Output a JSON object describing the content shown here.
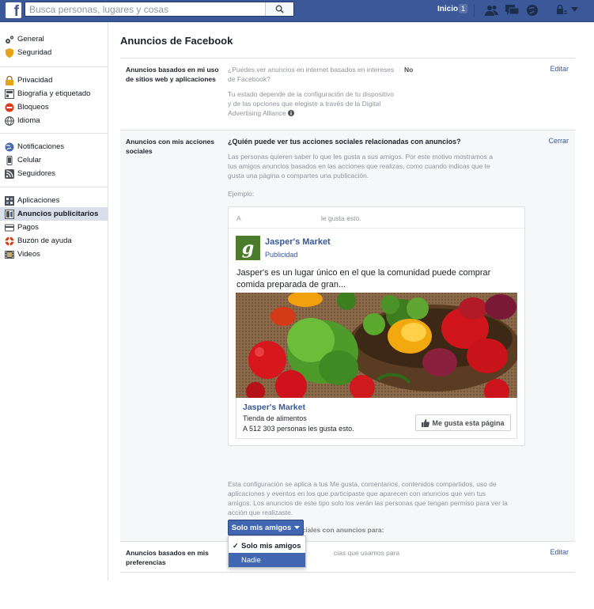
{
  "topbar": {
    "logo": "f",
    "search_placeholder": "Busca personas, lugares y cosas",
    "home_label": "Inicio",
    "home_count": "1"
  },
  "sidebar": {
    "groups": [
      [
        {
          "label": "General",
          "icon": "gear-icon"
        },
        {
          "label": "Seguridad",
          "icon": "shield-icon"
        }
      ],
      [
        {
          "label": "Privacidad",
          "icon": "lock-icon"
        },
        {
          "label": "Biografía y etiquetado",
          "icon": "timeline-icon"
        },
        {
          "label": "Bloqueos",
          "icon": "block-icon"
        },
        {
          "label": "Idioma",
          "icon": "globe-icon"
        }
      ],
      [
        {
          "label": "Notificaciones",
          "icon": "globe-icon"
        },
        {
          "label": "Celular",
          "icon": "mobile-icon"
        },
        {
          "label": "Seguidores",
          "icon": "rss-icon"
        }
      ],
      [
        {
          "label": "Aplicaciones",
          "icon": "apps-icon"
        },
        {
          "label": "Anuncios publicitarios",
          "icon": "ads-icon",
          "active": true
        },
        {
          "label": "Pagos",
          "icon": "card-icon"
        },
        {
          "label": "Buzón de ayuda",
          "icon": "lifebuoy-icon"
        },
        {
          "label": "Videos",
          "icon": "film-icon"
        }
      ]
    ]
  },
  "main": {
    "title": "Anuncios de Facebook",
    "row1": {
      "label": "Anuncios basados en mi uso de sitios web y aplicaciones",
      "question": "¿Puedes ver anuncios en internet basados en intereses de Facebook?",
      "value": "No",
      "note": "Tu estado depende de la configuración de tu dispositivo y de las opciones que elegiste a través de la Digital Advertising Alliance",
      "action": "Editar"
    },
    "row2": {
      "label": "Anuncios con mis acciones sociales",
      "question": "¿Quién puede ver tus acciones sociales relacionadas con anuncios?",
      "action": "Cerrar",
      "desc": "Las personas quieren saber lo que les gusta a sus amigos. Por este motivo mostramos a tus amigos anuncios basados en las acciones que realizas, como cuando indicas que te gusta una página o compartes una publicación.",
      "example_label": "Ejemplo:",
      "card": {
        "top_prefix": "A",
        "top_suffix": "le gusta esto.",
        "logo_letter": "g",
        "brand": "Jasper's Market",
        "sponsored": "Publicidad",
        "text": "Jasper's es un lugar único en el que la comunidad puede comprar comida preparada de gran...",
        "bottom_brand": "Jasper's Market",
        "category": "Tienda de alimentos",
        "likes": "A 512 303 personas les gusta esto.",
        "like_button": "Me gusta esta página"
      },
      "footer": "Esta configuración se aplica a tus Me gusta, comentarios, contenidos compartidos, uso de aplicaciones y eventos en los que participaste que aparecen con anuncios que ven tus amigos. Los anuncios de este tipo solo los verán las personas que tengan permiso para ver la acción que realizaste.",
      "include_label": "Incluir mis acciones sociales con anuncios para:",
      "dropdown": {
        "selected": "Solo mis amigos",
        "options": [
          "Solo mis amigos",
          "Nadie"
        ]
      }
    },
    "row3": {
      "label": "Anuncios basados en mis preferencias",
      "desc_visible": "cias que usamos para",
      "action": "Editar"
    }
  },
  "colors": {
    "brand_blue": "#3b5998",
    "link_blue": "#365899",
    "button_blue": "#4267b2"
  }
}
